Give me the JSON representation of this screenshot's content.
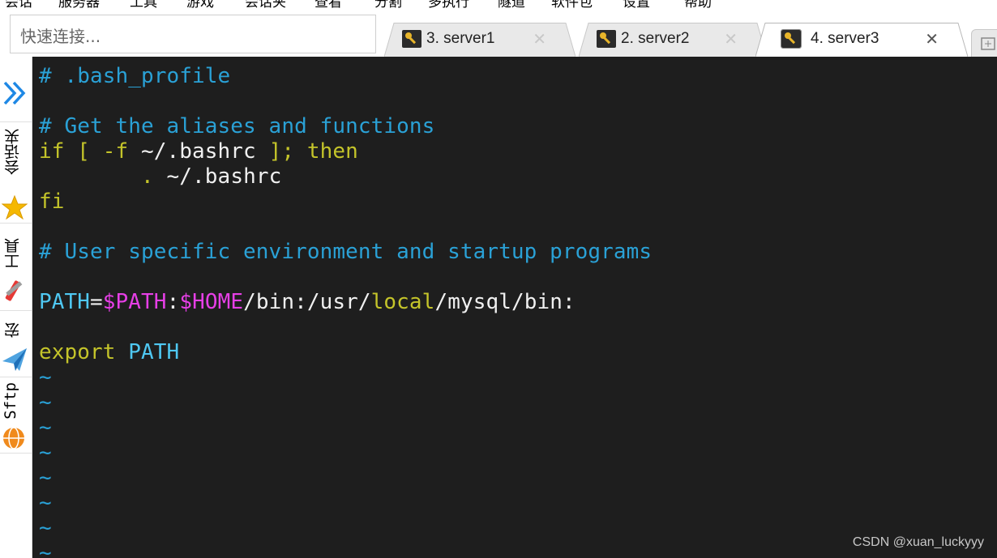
{
  "menubar": {
    "items": [
      "会话",
      "服务器",
      "工具",
      "游戏",
      "会话夹",
      "查看",
      "分割",
      "多执行",
      "隧道",
      "软件包",
      "设置",
      "帮助"
    ]
  },
  "quick_connect": {
    "placeholder": "快速连接..."
  },
  "tabs": [
    {
      "label": "3. server1",
      "active": false,
      "icon": "key-icon"
    },
    {
      "label": "2. server2",
      "active": false,
      "icon": "key-icon"
    },
    {
      "label": "4. server3",
      "active": true,
      "icon": "key-icon"
    }
  ],
  "sidebar": {
    "items": [
      {
        "label": "会话夹",
        "icon": "star-icon"
      },
      {
        "label": "工具",
        "icon": "tools-icon"
      },
      {
        "label": "宏",
        "icon": "paper-plane-icon"
      },
      {
        "label": "Sftp",
        "icon": "globe-icon"
      }
    ]
  },
  "terminal": {
    "lines": [
      {
        "segments": [
          {
            "text": "# .bash_profile",
            "color": "comment"
          }
        ]
      },
      {
        "segments": []
      },
      {
        "segments": [
          {
            "text": "# Get the aliases and functions",
            "color": "comment"
          }
        ]
      },
      {
        "segments": [
          {
            "text": "if [ -f ",
            "color": "yellow"
          },
          {
            "text": "~/.bashrc ",
            "color": "white"
          },
          {
            "text": "]; then",
            "color": "yellow"
          }
        ]
      },
      {
        "segments": [
          {
            "text": "        . ",
            "color": "yellow"
          },
          {
            "text": "~/.bashrc",
            "color": "white"
          }
        ]
      },
      {
        "segments": [
          {
            "text": "fi",
            "color": "yellow"
          }
        ]
      },
      {
        "segments": []
      },
      {
        "segments": [
          {
            "text": "# User specific environment and startup programs",
            "color": "comment"
          }
        ]
      },
      {
        "segments": []
      },
      {
        "segments": [
          {
            "text": "PATH",
            "color": "cyan"
          },
          {
            "text": "=",
            "color": "white"
          },
          {
            "text": "$PATH",
            "color": "magenta"
          },
          {
            "text": ":",
            "color": "white"
          },
          {
            "text": "$HOME",
            "color": "magenta"
          },
          {
            "text": "/bin:/usr/",
            "color": "white"
          },
          {
            "text": "local",
            "color": "yellow"
          },
          {
            "text": "/mysql/bin:",
            "color": "white"
          }
        ]
      },
      {
        "segments": []
      },
      {
        "segments": [
          {
            "text": "export ",
            "color": "yellow"
          },
          {
            "text": "PATH",
            "color": "cyan"
          }
        ]
      },
      {
        "segments": [
          {
            "text": "~",
            "color": "tilde"
          }
        ]
      },
      {
        "segments": [
          {
            "text": "~",
            "color": "tilde"
          }
        ]
      },
      {
        "segments": [
          {
            "text": "~",
            "color": "tilde"
          }
        ]
      },
      {
        "segments": [
          {
            "text": "~",
            "color": "tilde"
          }
        ]
      },
      {
        "segments": [
          {
            "text": "~",
            "color": "tilde"
          }
        ]
      },
      {
        "segments": [
          {
            "text": "~",
            "color": "tilde"
          }
        ]
      },
      {
        "segments": [
          {
            "text": "~",
            "color": "tilde"
          }
        ]
      },
      {
        "segments": [
          {
            "text": "~",
            "color": "tilde"
          }
        ]
      }
    ]
  },
  "watermark": "CSDN @xuan_luckyyy",
  "colors": {
    "terminal_bg": "#1e1e1e",
    "comment": "#2aa1d6",
    "keyword": "#c4c42a",
    "variable": "#e63fe6",
    "identifier": "#4fc8f2"
  }
}
